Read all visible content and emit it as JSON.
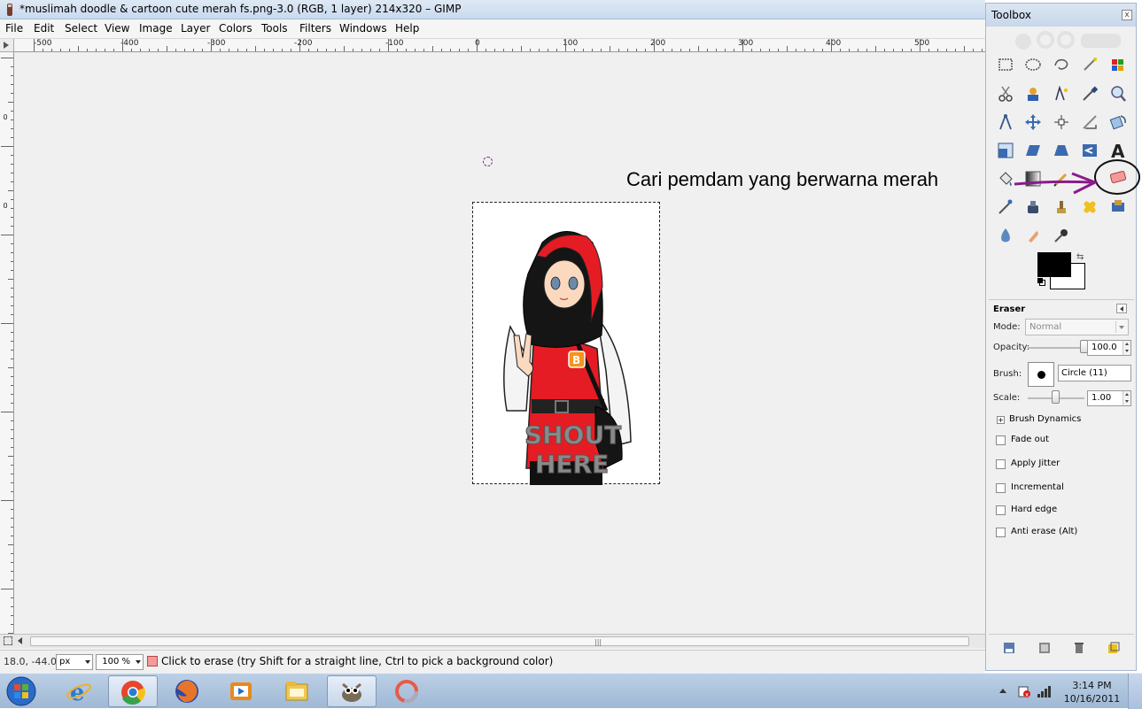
{
  "window": {
    "title": "*muslimah doodle & cartoon cute merah fs.png-3.0 (RGB, 1 layer) 214x320 – GIMP"
  },
  "menu": [
    "File",
    "Edit",
    "Select",
    "View",
    "Image",
    "Layer",
    "Colors",
    "Tools",
    "Filters",
    "Windows",
    "Help"
  ],
  "ruler": {
    "horizontal": [
      "-500",
      "-400",
      "-300",
      "-200",
      "-100",
      "0",
      "100",
      "200",
      "300",
      "400",
      "500"
    ],
    "vertical": [
      "0",
      "100",
      "0",
      "100",
      "200",
      "300",
      "400"
    ]
  },
  "canvas": {
    "annotation": "Cari pemdam yang berwarna merah",
    "image_text": [
      "SHOUT",
      "HERE"
    ]
  },
  "statusbar": {
    "coords": "18.0, -44.0",
    "unit": "px",
    "zoom": "100 %",
    "message": "Click to erase (try Shift for a straight line, Ctrl to pick a background color)"
  },
  "toolbox": {
    "title": "Toolbox",
    "close": "x",
    "swap_symbol": "⇆",
    "tool_options": {
      "title": "Eraser",
      "mode_label": "Mode:",
      "mode_value": "Normal",
      "opacity_label": "Opacity:",
      "opacity_value": "100.0",
      "opacity_level": 1.0,
      "brush_label": "Brush:",
      "brush_value": "Circle (11)",
      "scale_label": "Scale:",
      "scale_value": "1.00",
      "scale_level": 0.5,
      "brush_dynamics": "Brush Dynamics",
      "checkboxes": [
        "Fade out",
        "Apply Jitter",
        "Incremental",
        "Hard edge",
        "Anti erase  (Alt)"
      ]
    }
  },
  "taskbar": {
    "time": "3:14 PM",
    "date": "10/16/2011"
  },
  "colors": {
    "accent_purple": "#8b1a8b",
    "eraser_red": "#f29b9b",
    "foreground": "#000000",
    "background": "#ffffff"
  }
}
